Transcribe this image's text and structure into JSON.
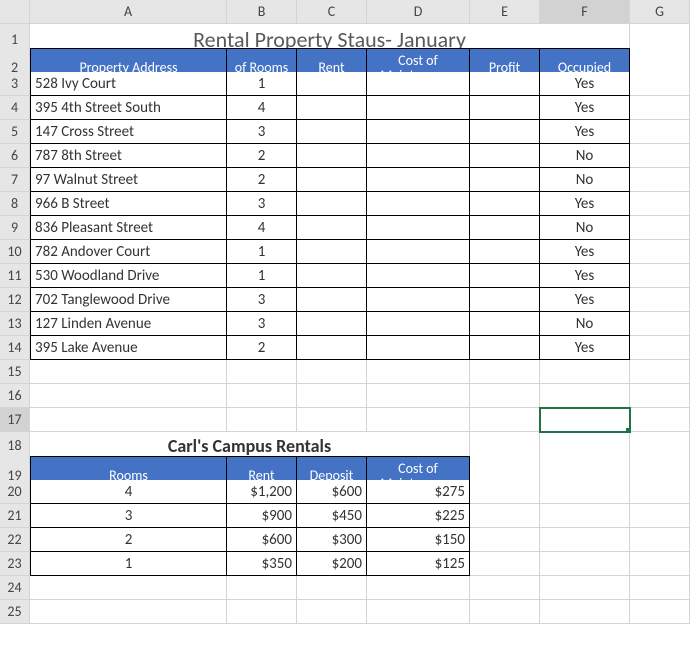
{
  "columns": [
    "A",
    "B",
    "C",
    "D",
    "E",
    "F",
    "G"
  ],
  "row_numbers": [
    1,
    2,
    3,
    4,
    5,
    6,
    7,
    8,
    9,
    10,
    11,
    12,
    13,
    14,
    15,
    16,
    17,
    18,
    19,
    20,
    21,
    22,
    23,
    24,
    25
  ],
  "active_cell": "F17",
  "table1": {
    "title": "Rental Property Staus- January",
    "headers": [
      "Property Address",
      "of Rooms",
      "Rent",
      "Cost of Maintenence",
      "Profit",
      "Occupied"
    ],
    "rows": [
      {
        "addr": "528 Ivy Court",
        "rooms": "1",
        "rent": "",
        "cost": "",
        "profit": "",
        "occ": "Yes"
      },
      {
        "addr": "395 4th Street South",
        "rooms": "4",
        "rent": "",
        "cost": "",
        "profit": "",
        "occ": "Yes"
      },
      {
        "addr": "147 Cross Street",
        "rooms": "3",
        "rent": "",
        "cost": "",
        "profit": "",
        "occ": "Yes"
      },
      {
        "addr": "787 8th Street",
        "rooms": "2",
        "rent": "",
        "cost": "",
        "profit": "",
        "occ": "No"
      },
      {
        "addr": "97 Walnut Street",
        "rooms": "2",
        "rent": "",
        "cost": "",
        "profit": "",
        "occ": "No"
      },
      {
        "addr": "966 B Street",
        "rooms": "3",
        "rent": "",
        "cost": "",
        "profit": "",
        "occ": "Yes"
      },
      {
        "addr": "836 Pleasant Street",
        "rooms": "4",
        "rent": "",
        "cost": "",
        "profit": "",
        "occ": "No"
      },
      {
        "addr": "782 Andover Court",
        "rooms": "1",
        "rent": "",
        "cost": "",
        "profit": "",
        "occ": "Yes"
      },
      {
        "addr": "530 Woodland Drive",
        "rooms": "1",
        "rent": "",
        "cost": "",
        "profit": "",
        "occ": "Yes"
      },
      {
        "addr": "702 Tanglewood Drive",
        "rooms": "3",
        "rent": "",
        "cost": "",
        "profit": "",
        "occ": "Yes"
      },
      {
        "addr": "127 Linden Avenue",
        "rooms": "3",
        "rent": "",
        "cost": "",
        "profit": "",
        "occ": "No"
      },
      {
        "addr": "395 Lake Avenue",
        "rooms": "2",
        "rent": "",
        "cost": "",
        "profit": "",
        "occ": "Yes"
      }
    ]
  },
  "table2": {
    "title": "Carl's Campus Rentals",
    "headers": [
      "Rooms",
      "Rent",
      "Deposit",
      "Cost of Maintenence"
    ],
    "rows": [
      {
        "rooms": "4",
        "rent": "$1,200",
        "deposit": "$600",
        "cost": "$275"
      },
      {
        "rooms": "3",
        "rent": "$900",
        "deposit": "$450",
        "cost": "$225"
      },
      {
        "rooms": "2",
        "rent": "$600",
        "deposit": "$300",
        "cost": "$150"
      },
      {
        "rooms": "1",
        "rent": "$350",
        "deposit": "$200",
        "cost": "$125"
      }
    ]
  }
}
